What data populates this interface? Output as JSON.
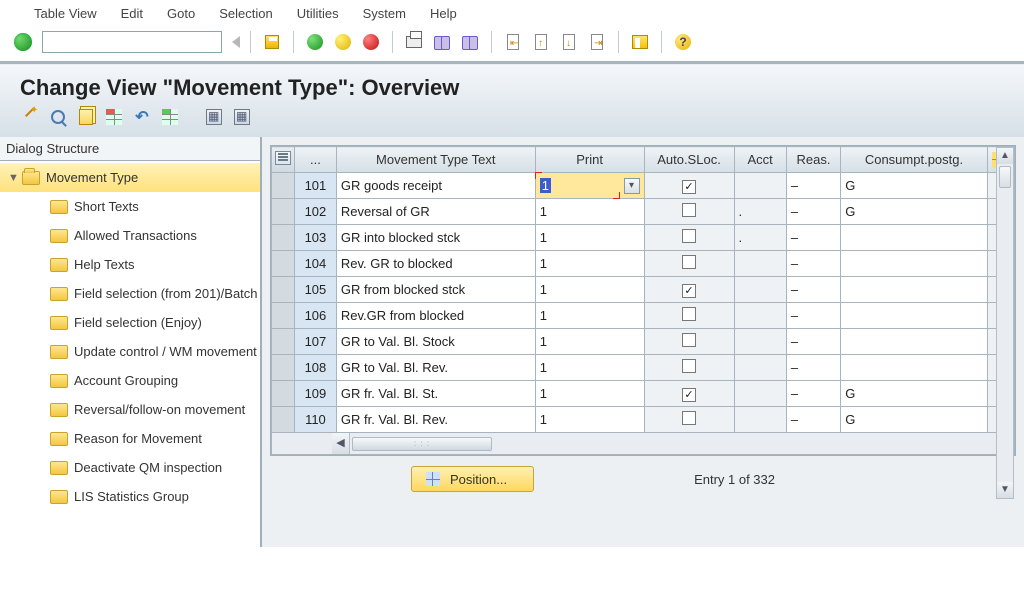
{
  "menu": [
    "Table View",
    "Edit",
    "Goto",
    "Selection",
    "Utilities",
    "System",
    "Help"
  ],
  "title": "Change View \"Movement Type\": Overview",
  "sidebar": {
    "header": "Dialog Structure",
    "root": "Movement Type",
    "children": [
      "Short Texts",
      "Allowed Transactions",
      "Help Texts",
      "Field selection (from 201)/Batch",
      "Field selection (Enjoy)",
      "Update control / WM movement",
      "Account Grouping",
      "Reversal/follow-on movement",
      "Reason for Movement",
      "Deactivate QM inspection",
      "LIS Statistics Group"
    ]
  },
  "table": {
    "headers": {
      "sel": "...",
      "text": "Movement Type Text",
      "print": "Print",
      "sloc": "Auto.SLoc.",
      "acct": "Acct",
      "reas": "Reas.",
      "cons": "Consumpt.postg."
    },
    "rows": [
      {
        "code": "101",
        "text": "GR goods receipt",
        "print": "1",
        "sloc": true,
        "acct": "",
        "reas": "–",
        "cons": "G",
        "active": true
      },
      {
        "code": "102",
        "text": "Reversal of GR",
        "print": "1",
        "sloc": false,
        "acct": ".",
        "reas": "–",
        "cons": "G"
      },
      {
        "code": "103",
        "text": "GR into blocked stck",
        "print": "1",
        "sloc": false,
        "acct": ".",
        "reas": "–",
        "cons": ""
      },
      {
        "code": "104",
        "text": "Rev. GR to blocked",
        "print": "1",
        "sloc": false,
        "acct": "",
        "reas": "–",
        "cons": ""
      },
      {
        "code": "105",
        "text": "GR from blocked stck",
        "print": "1",
        "sloc": true,
        "acct": "",
        "reas": "–",
        "cons": ""
      },
      {
        "code": "106",
        "text": "Rev.GR from blocked",
        "print": "1",
        "sloc": false,
        "acct": "",
        "reas": "–",
        "cons": ""
      },
      {
        "code": "107",
        "text": "GR to Val. Bl. Stock",
        "print": "1",
        "sloc": false,
        "acct": "",
        "reas": "–",
        "cons": ""
      },
      {
        "code": "108",
        "text": "GR to Val. Bl. Rev.",
        "print": "1",
        "sloc": false,
        "acct": "",
        "reas": "–",
        "cons": ""
      },
      {
        "code": "109",
        "text": "GR fr. Val. Bl. St.",
        "print": "1",
        "sloc": true,
        "acct": "",
        "reas": "–",
        "cons": "G"
      },
      {
        "code": "110",
        "text": "GR fr. Val. Bl. Rev.",
        "print": "1",
        "sloc": false,
        "acct": "",
        "reas": "–",
        "cons": "G"
      }
    ]
  },
  "footer": {
    "position_label": "Position...",
    "entry_text": "Entry 1 of 332"
  }
}
